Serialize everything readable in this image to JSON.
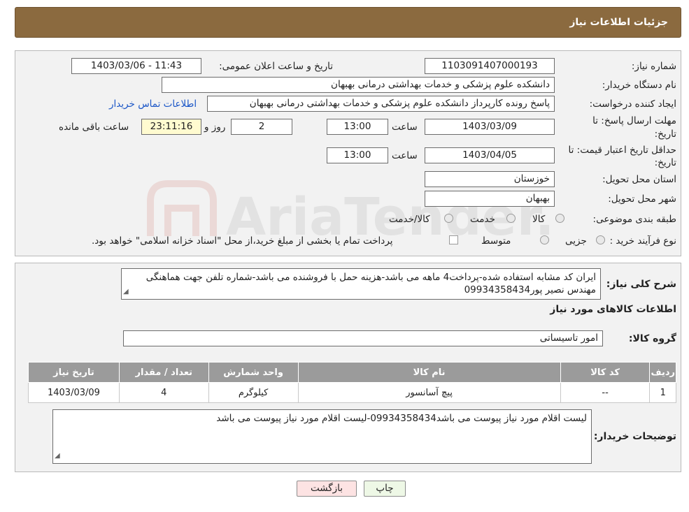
{
  "header": {
    "title": "جزئیات اطلاعات نیاز"
  },
  "form": {
    "need_number": {
      "label": "شماره نیاز:",
      "value": "1103091407000193"
    },
    "announce_datetime": {
      "label": "تاریخ و ساعت اعلان عمومی:",
      "value": "1403/03/06 - 11:43"
    },
    "buyer_org": {
      "label": "نام دستگاه خریدار:",
      "value": "دانشکده علوم پزشکی و خدمات بهداشتی  درمانی بهبهان"
    },
    "requester": {
      "label": "ایجاد کننده درخواست:",
      "value": "پاسخ رونده کارپرداز دانشکده علوم پزشکی و خدمات بهداشتی  درمانی بهبهان",
      "contact_link": "اطلاعات تماس خریدار"
    },
    "reply_deadline": {
      "label_line1": "مهلت ارسال پاسخ: تا",
      "label_line2": "تاریخ:",
      "date": "1403/03/09",
      "time_label": "ساعت",
      "time": "13:00",
      "days": "2",
      "days_label": "روز و",
      "remaining": "23:11:16",
      "remaining_label": "ساعت باقی مانده"
    },
    "price_validity": {
      "label_line1": "حداقل تاریخ اعتبار قیمت: تا",
      "label_line2": "تاریخ:",
      "date": "1403/04/05",
      "time_label": "ساعت",
      "time": "13:00"
    },
    "province": {
      "label": "استان محل تحویل:",
      "value": "خوزستان"
    },
    "city": {
      "label": "شهر محل تحویل:",
      "value": "بهبهان"
    },
    "category": {
      "label": "طبقه بندی موضوعی:",
      "options": [
        "کالا",
        "خدمت",
        "کالا/خدمت"
      ]
    },
    "purchase_type": {
      "label": "نوع فرآیند خرید :",
      "options": [
        "جزیی",
        "متوسط"
      ],
      "note": "پرداخت تمام یا بخشی از مبلغ خرید،از محل \"اسناد خزانه اسلامی\" خواهد بود."
    }
  },
  "description": {
    "label": "شرح کلی نیاز:",
    "value": "ایران کد مشابه استفاده شده-پرداخت4 ماهه می باشد-هزینه حمل با فروشنده می باشد-شماره تلفن جهت هماهنگی مهندس نصیر پور09934358434"
  },
  "goods_section": {
    "title": "اطلاعات کالاهای مورد نیاز",
    "group_label": "گروه کالا:",
    "group_value": "امور تاسیساتی"
  },
  "table": {
    "headers": [
      "ردیف",
      "کد کالا",
      "نام کالا",
      "واحد شمارش",
      "تعداد / مقدار",
      "تاریخ نیاز"
    ],
    "rows": [
      [
        "1",
        "--",
        "پیچ آسانسور",
        "کیلوگرم",
        "4",
        "1403/03/09"
      ]
    ]
  },
  "buyer_notes": {
    "label": "توضیحات خریدار:",
    "value": "لیست اقلام مورد نیاز پیوست می باشد09934358434-لیست اقلام مورد نیاز پیوست می باشد"
  },
  "buttons": {
    "print": "چاپ",
    "back": "بازگشت"
  },
  "watermark": {
    "text": "AriaTender.neT"
  },
  "colors": {
    "header_bg": "#8b6a3f",
    "link": "#1a56c7",
    "table_header": "#9b9b9b",
    "back_btn": "#fde3e3",
    "print_btn": "#eef8e6"
  }
}
